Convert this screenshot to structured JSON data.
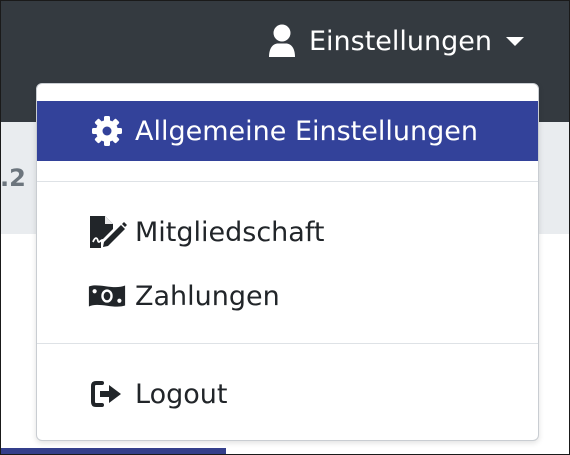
{
  "navbar": {
    "user_menu_label": "Einstellungen",
    "user_icon": "user-icon",
    "caret_icon": "caret-down-icon"
  },
  "subbar": {
    "partial_text": ".2"
  },
  "dropdown": {
    "items": [
      {
        "label": "Allgemeine Einstellungen",
        "icon": "gear-icon",
        "active": true
      },
      {
        "label": "Mitgliedschaft",
        "icon": "file-signature-icon",
        "active": false
      },
      {
        "label": "Zahlungen",
        "icon": "money-bill-icon",
        "active": false
      },
      {
        "label": "Logout",
        "icon": "sign-out-icon",
        "active": false
      }
    ]
  },
  "colors": {
    "navbar_bg": "#343a40",
    "active_item_bg": "#33429a",
    "subbar_bg": "#e9ecef",
    "tab_underline": "#343f8b"
  }
}
